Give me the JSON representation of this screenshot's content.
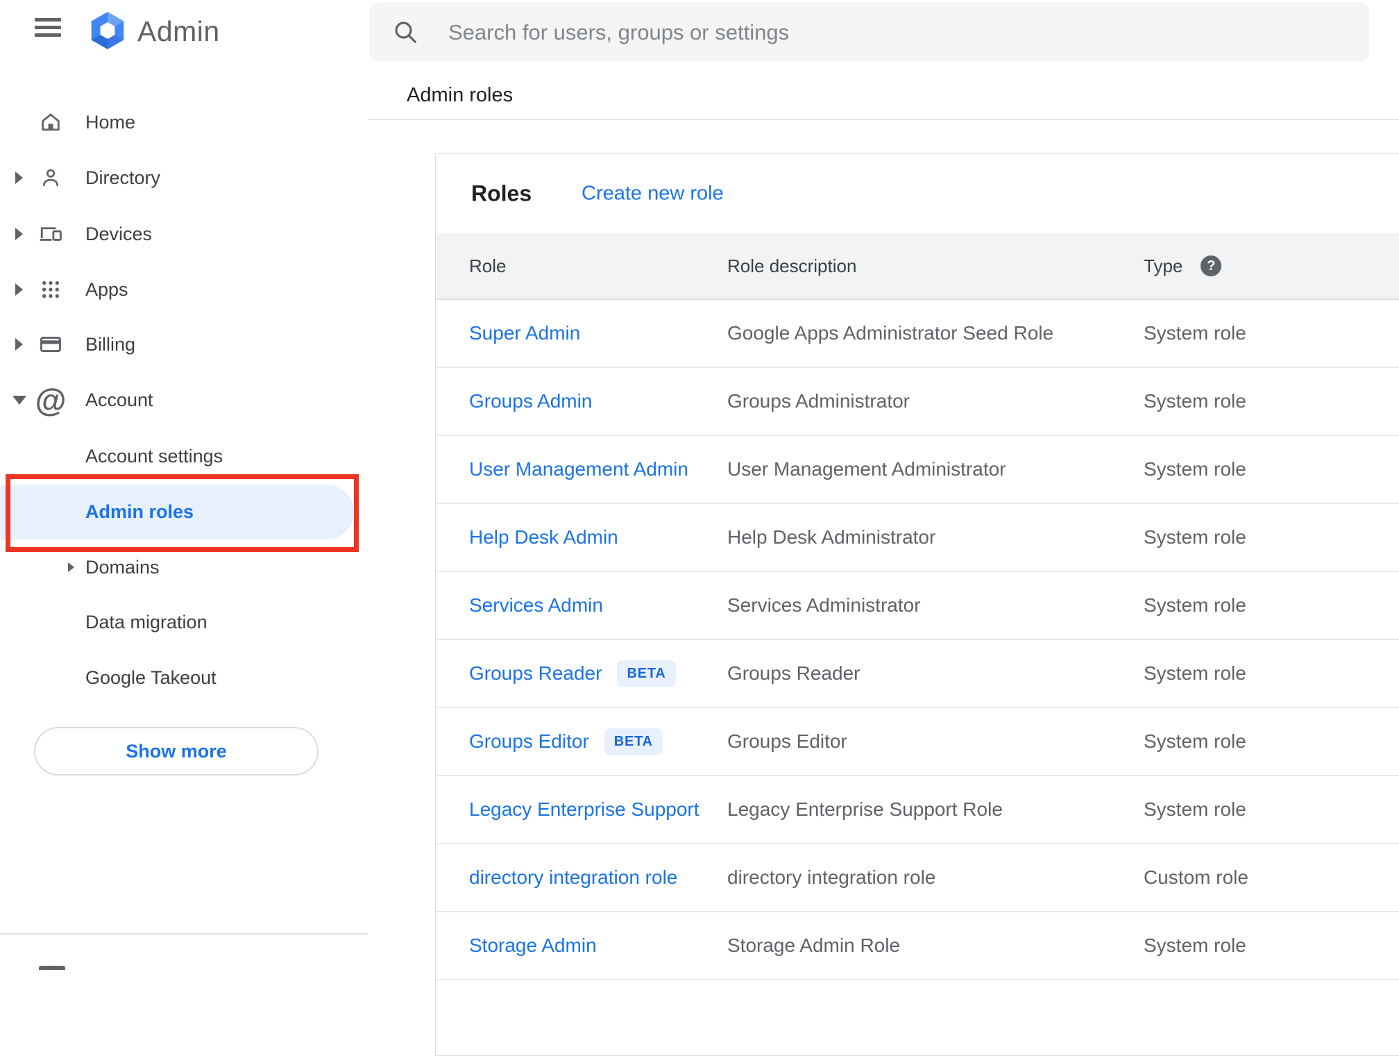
{
  "app": {
    "name": "Admin"
  },
  "topbar": {
    "search_placeholder": "Search for users, groups or settings",
    "breadcrumb": "Admin roles"
  },
  "sidebar": {
    "items": [
      {
        "label": "Home",
        "icon": "home-icon",
        "expandable": false
      },
      {
        "label": "Directory",
        "icon": "person-icon",
        "expandable": true
      },
      {
        "label": "Devices",
        "icon": "devices-icon",
        "expandable": true
      },
      {
        "label": "Apps",
        "icon": "apps-grid-icon",
        "expandable": true
      },
      {
        "label": "Billing",
        "icon": "credit-card-icon",
        "expandable": true
      },
      {
        "label": "Account",
        "icon": "at-sign-icon",
        "expandable": true,
        "expanded": true
      }
    ],
    "account_children": [
      {
        "label": "Account settings",
        "selected": false
      },
      {
        "label": "Admin roles",
        "selected": true
      },
      {
        "label": "Domains",
        "expandable": true
      },
      {
        "label": "Data migration"
      },
      {
        "label": "Google Takeout"
      }
    ],
    "show_more_label": "Show more"
  },
  "panel": {
    "title": "Roles",
    "create_link": "Create new role",
    "columns": {
      "role": "Role",
      "description": "Role description",
      "type": "Type"
    },
    "type_help_glyph": "?",
    "rows": [
      {
        "role": "Super Admin",
        "description": "Google Apps Administrator Seed Role",
        "type": "System role"
      },
      {
        "role": "Groups Admin",
        "description": "Groups Administrator",
        "type": "System role"
      },
      {
        "role": "User Management Admin",
        "description": "User Management Administrator",
        "type": "System role"
      },
      {
        "role": "Help Desk Admin",
        "description": "Help Desk Administrator",
        "type": "System role"
      },
      {
        "role": "Services Admin",
        "description": "Services Administrator",
        "type": "System role"
      },
      {
        "role": "Groups Reader",
        "badge": "BETA",
        "description": "Groups Reader",
        "type": "System role"
      },
      {
        "role": "Groups Editor",
        "badge": "BETA",
        "description": "Groups Editor",
        "type": "System role"
      },
      {
        "role": "Legacy Enterprise Support",
        "description": "Legacy Enterprise Support Role",
        "type": "System role"
      },
      {
        "role": "directory integration role",
        "description": "directory integration role",
        "type": "Custom role"
      },
      {
        "role": "Storage Admin",
        "description": "Storage Admin Role",
        "type": "System role"
      }
    ]
  },
  "colors": {
    "accent_blue": "#1a73e8",
    "selected_item_bg": "#e8f0fe",
    "annotation_red": "#ee3524",
    "badge_bg": "#e8f0fe",
    "badge_text": "#1967d2",
    "table_header_bg": "#f1f3f4",
    "icon_gray": "#5f6368",
    "text_dark": "#3c4043",
    "logo_blue": "#4285f4"
  },
  "icons": [
    "hamburger-menu-icon",
    "admin-logo",
    "home-icon",
    "person-icon",
    "devices-icon",
    "apps-grid-icon",
    "credit-card-icon",
    "at-sign-icon",
    "expand-arrow-icon",
    "collapse-arrow-icon",
    "search-icon",
    "help-icon",
    "partial-scrolled-icon"
  ]
}
